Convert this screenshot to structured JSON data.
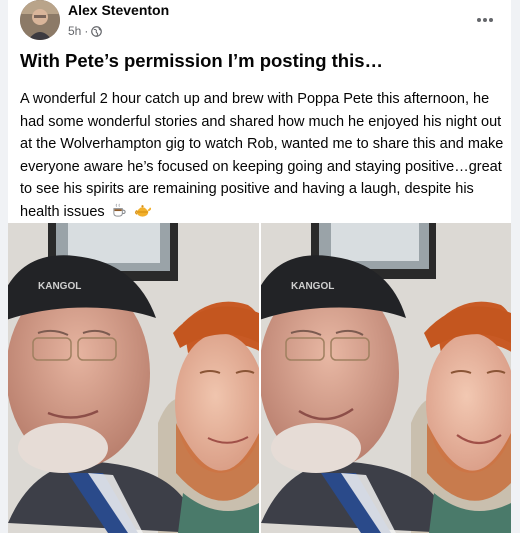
{
  "post": {
    "author": "Alex Steventon",
    "time": "5h",
    "separator": "·",
    "title": "With Pete’s permission I’m posting this…",
    "body": "A wonderful 2 hour catch up and brew with Poppa Pete this afternoon, he had some wonderful stories and shared how much he enjoyed his night out at the Wolverhampton gig to watch Rob, wanted me to share this and make everyone aware he’s focused on keeping going and staying positive…great to see his spirits are remaining positive and having a laugh, despite his health issues",
    "cap_text": "KANGOL"
  },
  "icons": {
    "visibility": "globe-icon",
    "more": "more-options-icon",
    "emoji_1": "hot-beverage-emoji",
    "emoji_2": "teapot-emoji"
  },
  "colors": {
    "background": "#f0f2f5",
    "card": "#ffffff",
    "text_primary": "#050505",
    "text_secondary": "#65676b"
  }
}
